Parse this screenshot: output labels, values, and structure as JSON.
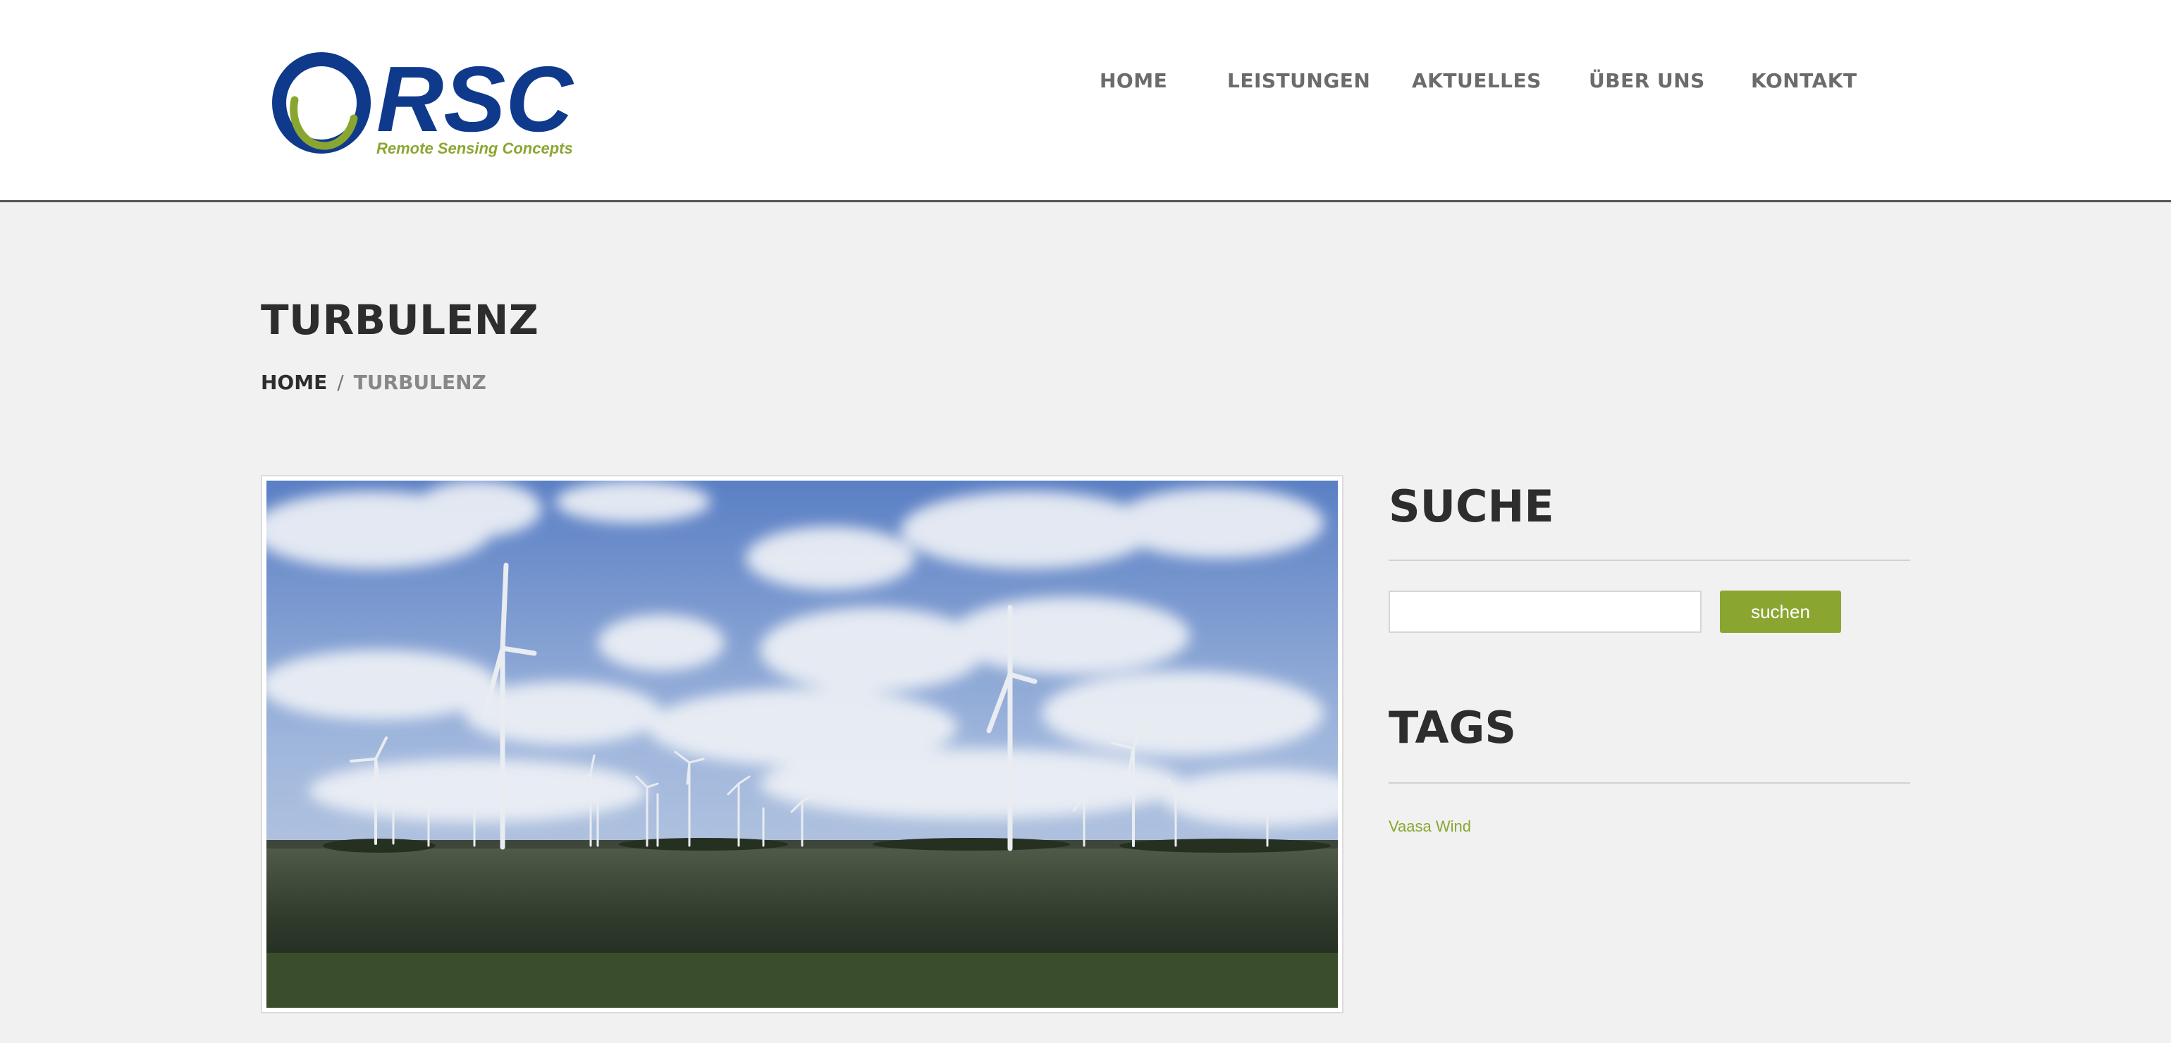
{
  "header": {
    "logo_text": "RSC",
    "logo_tagline": "Remote Sensing Concepts"
  },
  "nav": {
    "items": [
      {
        "label": "HOME"
      },
      {
        "label": "LEISTUNGEN"
      },
      {
        "label": "AKTUELLES"
      },
      {
        "label": "ÜBER UNS"
      },
      {
        "label": "KONTAKT"
      }
    ]
  },
  "page": {
    "title": "TURBULENZ",
    "breadcrumb": {
      "home": "HOME",
      "separator": "/",
      "current": "TURBULENZ"
    }
  },
  "sidebar": {
    "search": {
      "heading": "SUCHE",
      "input_value": "",
      "button_label": "suchen"
    },
    "tags": {
      "heading": "TAGS",
      "items": [
        "Vaasa Wind"
      ]
    }
  },
  "colors": {
    "brand_blue": "#0f3a8c",
    "brand_green": "#8aa631",
    "background": "#f1f1f1",
    "header_background": "#ffffff"
  }
}
